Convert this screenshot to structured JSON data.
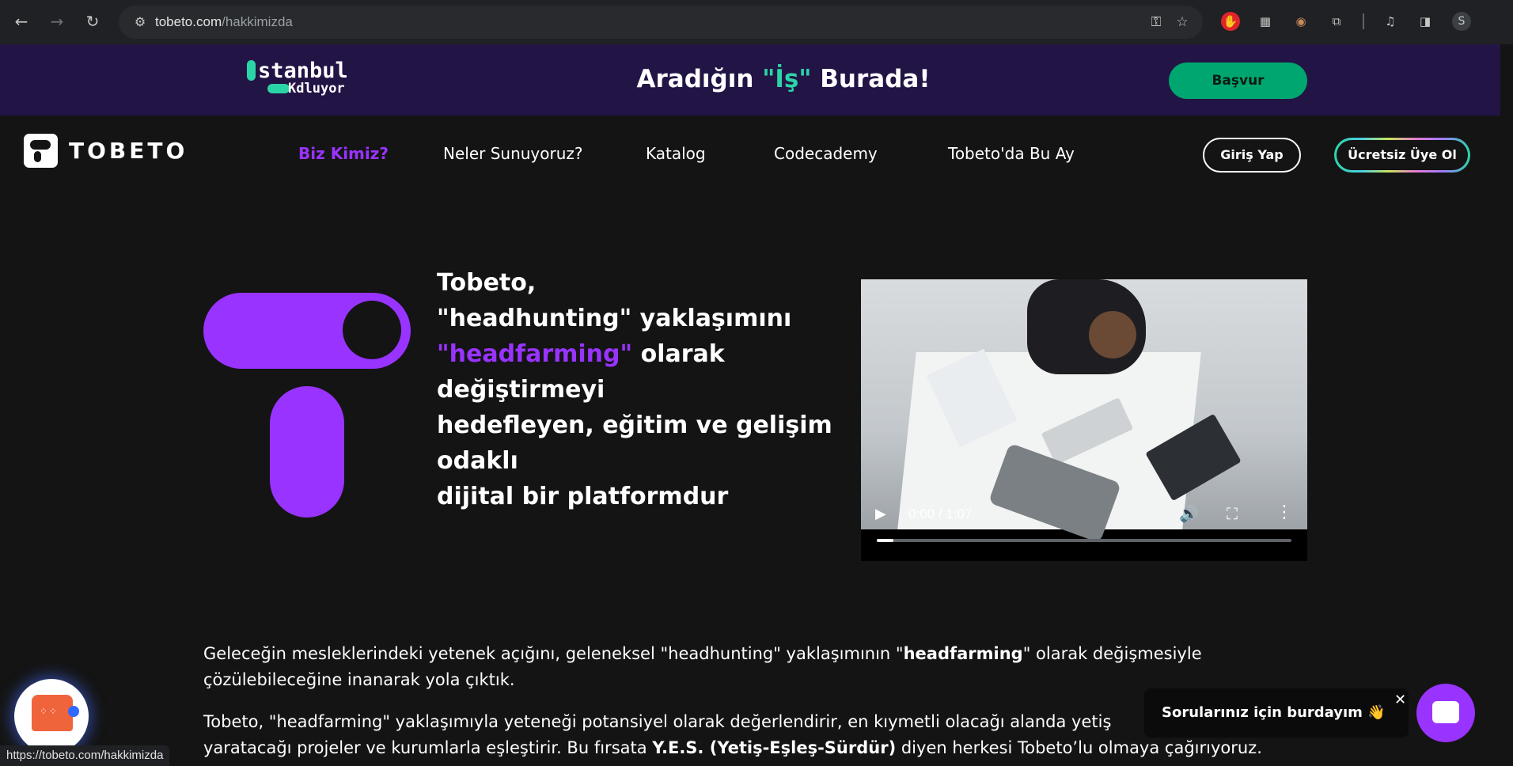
{
  "browser": {
    "url_host": "tobeto.com",
    "url_path": "/hakkimizda",
    "status_url": "https://tobeto.com/hakkimizda",
    "profile_initial": "S"
  },
  "promo": {
    "logo_top": "stanbul",
    "logo_bottom": "dluyor",
    "title_before": "Aradığın ",
    "title_highlight": "\"İş\"",
    "title_after": " Burada!",
    "apply_label": "Başvur",
    "accent_color": "#2bd4a6",
    "background_color": "#231446"
  },
  "site_nav": {
    "brand": "TOBETO",
    "menu": [
      {
        "label": "Biz Kimiz?",
        "active": true
      },
      {
        "label": "Neler Sunuyoruz?",
        "active": false
      },
      {
        "label": "Katalog",
        "active": false
      },
      {
        "label": "Codecademy",
        "active": false
      },
      {
        "label": "Tobeto'da Bu Ay",
        "active": false
      }
    ],
    "login_label": "Giriş Yap",
    "signup_label": "Ücretsiz Üye Ol",
    "accent_color": "#9933ff"
  },
  "hero": {
    "line1": "Tobeto,",
    "line2": "\"headhunting\" yaklaşımını",
    "line3_highlight": "\"headfarming\"",
    "line3_rest": " olarak",
    "line4": "değiştirmeyi",
    "line5": "hedefleyen, eğitim ve gelişim",
    "line6": "odaklı",
    "line7": "dijital bir platformdur"
  },
  "video": {
    "time": "0:00 / 1:07",
    "progress": 0.04
  },
  "body": {
    "p1_a": "Geleceğin mesleklerindeki yetenek açığını, geleneksel \"headhunting\" yaklaşımının \"",
    "p1_bold": "headfarming",
    "p1_b": "\" olarak değişmesiyle",
    "p1_line2": "çözülebileceğine inanarak yola çıktık.",
    "p2_line1": "Tobeto, \"headfarming\" yaklaşımıyla yeteneği potansiyel olarak değerlendirir, en kıymetli olacağı alanda yetiş",
    "p2_a": "yaratacağı projeler ve kurumlarla eşleştirir. Bu fırsata ",
    "p2_bold": "Y.E.S. (Yetiş-Eşleş-Sürdür)",
    "p2_b": " diyen herkesi Tobeto’lu olmaya çağırıyoruz."
  },
  "chat": {
    "tip": "Sorularınız için burdayım 👋",
    "close": "✕"
  }
}
